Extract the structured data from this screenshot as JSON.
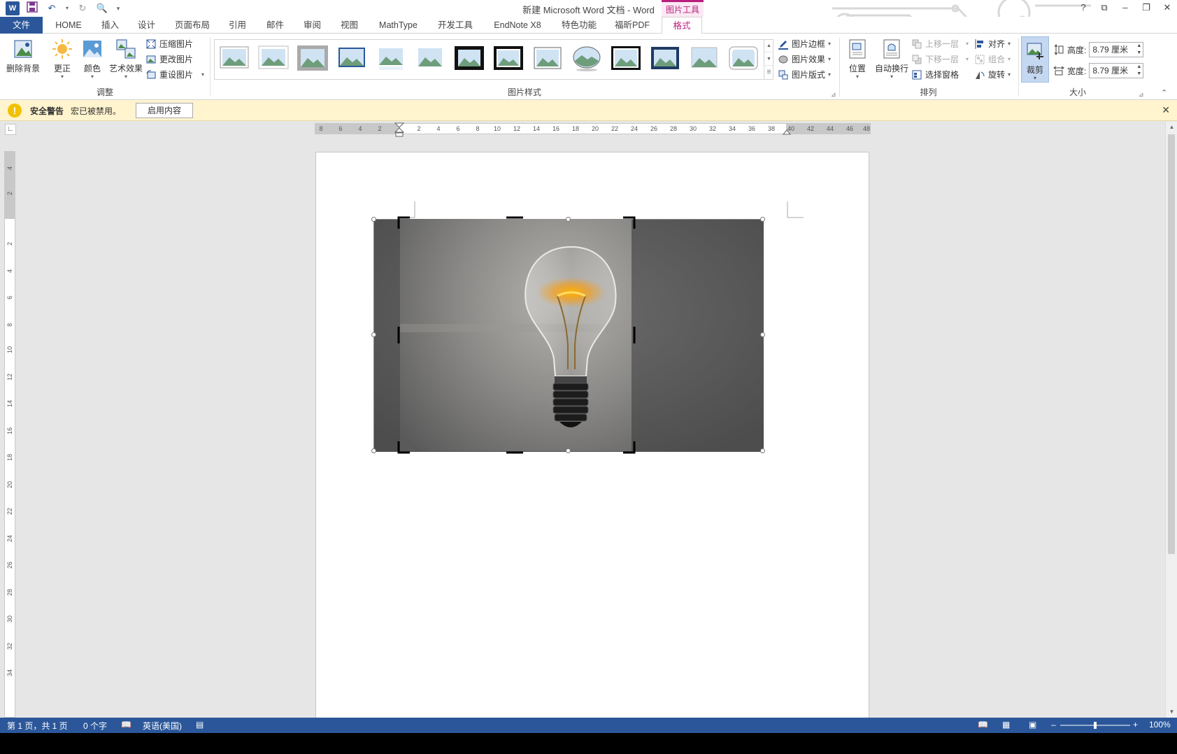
{
  "window": {
    "title": "新建 Microsoft Word 文档 - Word",
    "contextual_group": "图片工具"
  },
  "qat": {
    "app_icon": "word-icon",
    "save_icon": "save-icon",
    "undo_icon": "undo-icon",
    "redo_icon": "redo-icon",
    "print_preview_icon": "print-preview-icon",
    "customize_icon": "customize-icon"
  },
  "window_controls": {
    "help": "?",
    "ribbon_display": "⧉",
    "minimize": "–",
    "restore": "❐",
    "close": "✕"
  },
  "tabs": [
    {
      "label": "文件"
    },
    {
      "label": "HOME"
    },
    {
      "label": "插入"
    },
    {
      "label": "设计"
    },
    {
      "label": "页面布局"
    },
    {
      "label": "引用"
    },
    {
      "label": "邮件"
    },
    {
      "label": "审阅"
    },
    {
      "label": "视图"
    },
    {
      "label": "MathType"
    },
    {
      "label": "开发工具"
    },
    {
      "label": "EndNote X8"
    },
    {
      "label": "特色功能"
    },
    {
      "label": "福昕PDF"
    },
    {
      "label": "格式"
    }
  ],
  "ribbon": {
    "adjust": {
      "group_label": "调整",
      "remove_bg": "删除背景",
      "corrections": "更正",
      "color": "颜色",
      "artistic": "艺术效果",
      "compress": "压缩图片",
      "change": "更改图片",
      "reset": "重设图片"
    },
    "styles": {
      "group_label": "图片样式",
      "border": "图片边框",
      "effects": "图片效果",
      "layout": "图片版式"
    },
    "arrange": {
      "group_label": "排列",
      "position": "位置",
      "wrap": "自动换行",
      "bring_forward": "上移一层",
      "send_backward": "下移一层",
      "selection_pane": "选择窗格",
      "align": "对齐",
      "group": "组合",
      "rotate": "旋转"
    },
    "size": {
      "group_label": "大小",
      "crop": "裁剪",
      "height_label": "高度:",
      "height_value": "8.79 厘米",
      "width_label": "宽度:",
      "width_value": "8.79 厘米"
    }
  },
  "security_bar": {
    "title": "安全警告",
    "message": "宏已被禁用。",
    "button": "启用内容",
    "close": "✕"
  },
  "hruler_ticks": [
    "8",
    "6",
    "4",
    "2",
    "2",
    "4",
    "6",
    "8",
    "10",
    "12",
    "14",
    "16",
    "18",
    "20",
    "22",
    "24",
    "26",
    "28",
    "30",
    "32",
    "34",
    "36",
    "38",
    "40",
    "42",
    "44",
    "46",
    "48"
  ],
  "vruler_ticks": [
    "4",
    "2",
    "2",
    "4",
    "6",
    "8",
    "10",
    "12",
    "14",
    "16",
    "18",
    "20",
    "22",
    "24",
    "26",
    "28",
    "30",
    "32",
    "34"
  ],
  "statusbar": {
    "page": "第 1 页，共 1 页",
    "words": "0 个字",
    "language": "英语(美国)",
    "zoom": "100%",
    "zoom_minus": "–",
    "zoom_plus": "+"
  }
}
